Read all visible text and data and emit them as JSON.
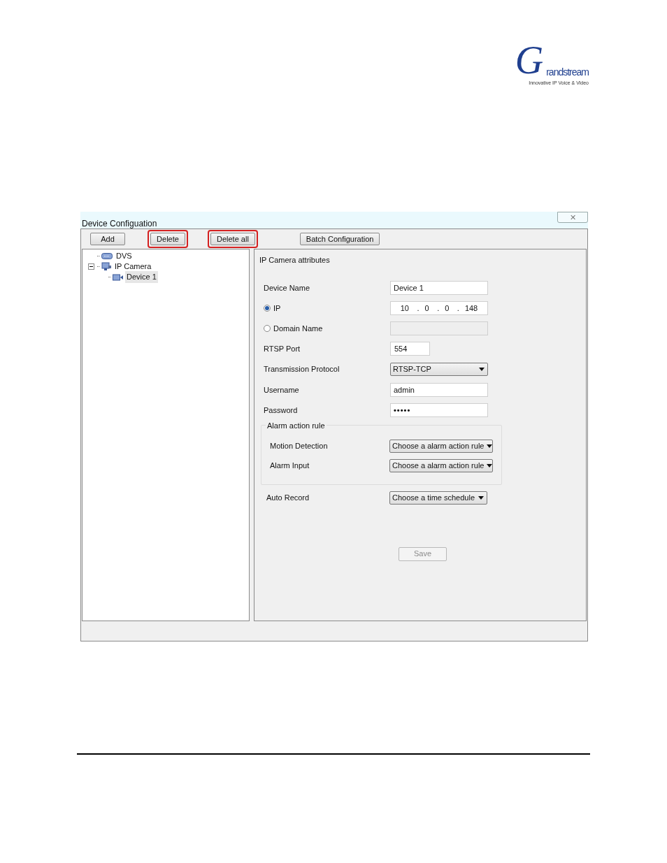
{
  "logo": {
    "mark": "G",
    "name": "randstream",
    "tagline": "Innovative IP Voice & Video"
  },
  "window": {
    "title": "Device Configuation",
    "close": "✕"
  },
  "toolbar": [
    {
      "label": "Add",
      "highlighted": false
    },
    {
      "label": "Delete",
      "highlighted": true
    },
    {
      "label": "Delete all",
      "highlighted": true
    },
    {
      "label": "Batch Configuration",
      "highlighted": false
    }
  ],
  "tree": [
    {
      "label": "DVS",
      "kind": "dvs",
      "selected": false
    },
    {
      "label": "IP Camera",
      "kind": "group",
      "expanded": true,
      "selected": false,
      "children": [
        {
          "label": "Device 1",
          "kind": "camera",
          "selected": true
        }
      ]
    }
  ],
  "panel": {
    "title": "IP Camera attributes",
    "fields": [
      {
        "kind": "text",
        "label": "Device Name",
        "value": "Device 1"
      },
      {
        "kind": "ip",
        "label": "IP",
        "selected": true,
        "octets": [
          "10",
          "0",
          "0",
          "148"
        ],
        "separator": "."
      },
      {
        "kind": "text",
        "label": "Domain Name",
        "selected": false,
        "disabled": true
      },
      {
        "kind": "short",
        "label": "RTSP Port",
        "value": "554"
      },
      {
        "kind": "select",
        "label": "Transmission Protocol",
        "value": "RTSP-TCP"
      },
      {
        "kind": "text",
        "label": "Username",
        "value": "admin"
      },
      {
        "kind": "password",
        "label": "Password",
        "value": "•••••"
      }
    ],
    "group": {
      "title": "Alarm action rule",
      "fields": [
        {
          "kind": "select",
          "label": "Motion Detection",
          "value": "Choose a alarm action rule"
        },
        {
          "kind": "select",
          "label": "Alarm Input",
          "value": "Choose a alarm action rule"
        }
      ]
    },
    "auto_record": {
      "kind": "select",
      "label": "Auto Record",
      "value": "Choose a time schedule"
    },
    "save": {
      "label": "Save",
      "disabled": true
    }
  }
}
